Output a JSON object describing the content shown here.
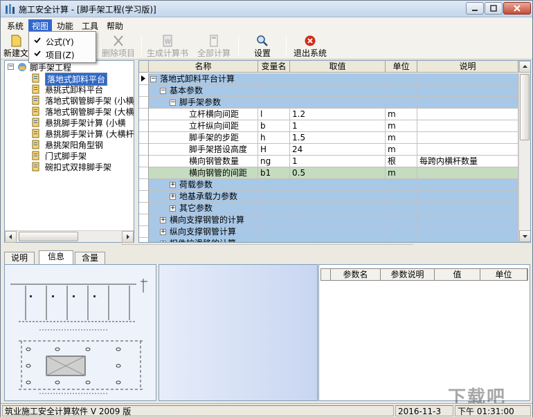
{
  "window": {
    "title": "施工安全计算 - [脚手架工程(学习版)]"
  },
  "menu": {
    "items": [
      "系统",
      "视图",
      "功能",
      "工具",
      "帮助"
    ]
  },
  "view_menu": {
    "items": [
      {
        "label": "公式(Y)",
        "checked": true
      },
      {
        "label": "项目(Z)",
        "checked": true
      }
    ]
  },
  "toolbar": {
    "new_label": "新建文",
    "delete_label": "删除项目",
    "generate_label": "生成计算书",
    "calc_all_label": "全部计算",
    "settings_label": "设置",
    "exit_label": "退出系统"
  },
  "tree": {
    "root": "脚手架工程",
    "items": [
      "落地式卸料平台",
      "悬挑式卸料平台",
      "落地式钢管脚手架 (小横",
      "落地式钢管脚手架 (大横",
      "悬挑脚手架计算 (小横",
      "悬挑脚手架计算 (大横杆",
      "悬挑架阳角型钢",
      "门式脚手架",
      "碗扣式双排脚手架"
    ]
  },
  "grid": {
    "headers": [
      "名称",
      "变量名",
      "取值",
      "单位",
      "说明"
    ],
    "rows": [
      {
        "level": 0,
        "toggle": "−",
        "name": "落地式卸料平台计算",
        "var": "",
        "val": "",
        "unit": "",
        "desc": "",
        "style": "band",
        "pointer": true
      },
      {
        "level": 1,
        "toggle": "−",
        "name": "基本参数",
        "var": "",
        "val": "",
        "unit": "",
        "desc": "",
        "style": "band"
      },
      {
        "level": 2,
        "toggle": "−",
        "name": "脚手架参数",
        "var": "",
        "val": "",
        "unit": "",
        "desc": "",
        "style": "band"
      },
      {
        "level": 3,
        "toggle": "",
        "name": "立杆横向间距",
        "var": "l",
        "val": "1.2",
        "unit": "m",
        "desc": "",
        "style": "plain"
      },
      {
        "level": 3,
        "toggle": "",
        "name": "立杆纵向间距",
        "var": "b",
        "val": "1",
        "unit": "m",
        "desc": "",
        "style": "plain"
      },
      {
        "level": 3,
        "toggle": "",
        "name": "脚手架的步距",
        "var": "h",
        "val": "1.5",
        "unit": "m",
        "desc": "",
        "style": "plain"
      },
      {
        "level": 3,
        "toggle": "",
        "name": "脚手架搭设高度",
        "var": "H",
        "val": "24",
        "unit": "m",
        "desc": "",
        "style": "plain"
      },
      {
        "level": 3,
        "toggle": "",
        "name": "横向钢管数量",
        "var": "ng",
        "val": "1",
        "unit": "根",
        "desc": "每跨内横杆数量",
        "style": "plain"
      },
      {
        "level": 3,
        "toggle": "",
        "name": "横向钢管的间距",
        "var": "b1",
        "val": "0.5",
        "unit": "m",
        "desc": "",
        "style": "bandg"
      },
      {
        "level": 2,
        "toggle": "+",
        "name": "荷载参数",
        "var": "",
        "val": "",
        "unit": "",
        "desc": "",
        "style": "band"
      },
      {
        "level": 2,
        "toggle": "+",
        "name": "地基承载力参数",
        "var": "",
        "val": "",
        "unit": "",
        "desc": "",
        "style": "band"
      },
      {
        "level": 2,
        "toggle": "+",
        "name": "其它参数",
        "var": "",
        "val": "",
        "unit": "",
        "desc": "",
        "style": "band"
      },
      {
        "level": 1,
        "toggle": "+",
        "name": "横向支撑钢管的计算",
        "var": "",
        "val": "",
        "unit": "",
        "desc": "",
        "style": "band"
      },
      {
        "level": 1,
        "toggle": "+",
        "name": "纵向支撑钢管计算",
        "var": "",
        "val": "",
        "unit": "",
        "desc": "",
        "style": "band"
      },
      {
        "level": 1,
        "toggle": "+",
        "name": "扣件抗滑移的计算",
        "var": "",
        "val": "",
        "unit": "",
        "desc": "",
        "style": "band"
      }
    ]
  },
  "bottom_tabs": {
    "items": [
      "说明",
      "信息",
      "含量"
    ],
    "active": 1
  },
  "params_table": {
    "headers": [
      "参数名",
      "参数说明",
      "值",
      "单位"
    ]
  },
  "status": {
    "product": "筑业施工安全计算软件 V 2009 版",
    "date": "2016-11-3",
    "time": "下午 01:31:00"
  },
  "colors": {
    "band": "#a8c8e8",
    "highlight_row": "#c5dcc0",
    "selection": "#316ac5"
  }
}
